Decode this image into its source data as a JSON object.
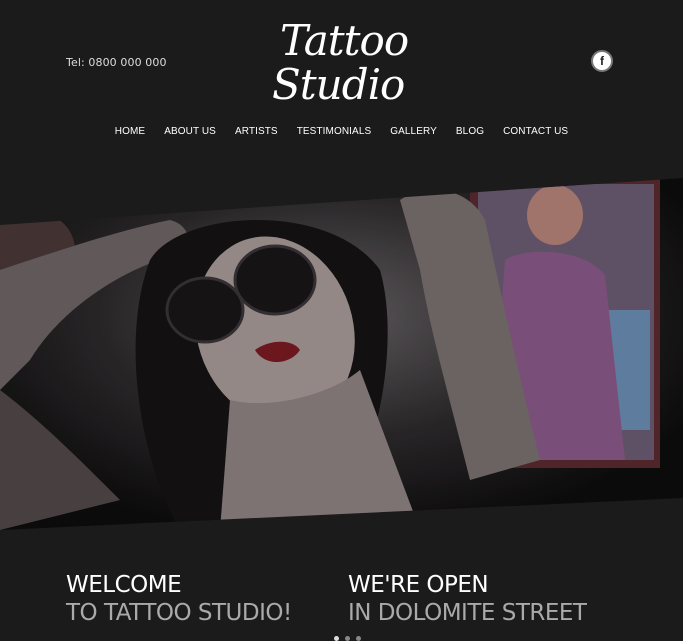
{
  "header": {
    "tel": "Tel: 0800 000 000",
    "logo_line1": "Tattoo",
    "logo_line2": "Studio",
    "facebook_glyph": "f"
  },
  "nav": {
    "items": [
      {
        "label": "HOME"
      },
      {
        "label": "ABOUT US"
      },
      {
        "label": "ARTISTS"
      },
      {
        "label": "TESTIMONIALS"
      },
      {
        "label": "GALLERY"
      },
      {
        "label": "BLOG"
      },
      {
        "label": "CONTACT US"
      }
    ]
  },
  "slider": {
    "slide_count": 3,
    "active_index": 0
  },
  "sections": {
    "welcome": {
      "line1": "WELCOME",
      "line2": "TO TATTOO STUDIO!"
    },
    "open": {
      "line1": "WE'RE OPEN",
      "line2": "IN DOLOMITE STREET"
    }
  },
  "colors": {
    "background": "#1b1b1b",
    "text": "#ffffff",
    "muted_text": "#aaaaaa"
  }
}
